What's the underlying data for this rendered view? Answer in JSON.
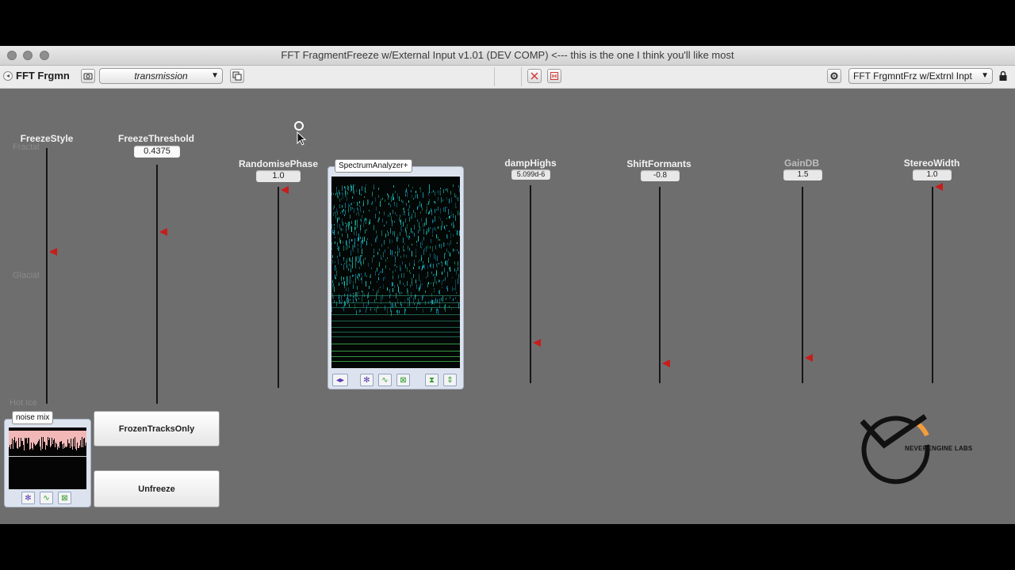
{
  "window": {
    "title": "FFT FragmentFreeze w/External Input v1.01 (DEV COMP)  <--- this is the one I think you'll like most"
  },
  "toolbar": {
    "device_name": "FFT Frgmn",
    "preset": "transmission",
    "device_select": "FFT FrgmntFrz w/Extrnl Inpt"
  },
  "params": {
    "freeze_style": {
      "label": "FreezeStyle",
      "options": [
        "Fractal",
        "Glacial",
        "Hot Ice"
      ]
    },
    "freeze_threshold": {
      "label": "FreezeThreshold",
      "value": "0.4375"
    },
    "randomise_phase": {
      "label": "RandomisePhase",
      "value": "1.0"
    },
    "damp_highs": {
      "label": "dampHighs",
      "value": "5.099d-6"
    },
    "shift_formants": {
      "label": "ShiftFormants",
      "value": "-0.8"
    },
    "gain_db": {
      "label": "GainDB",
      "value": "1.5"
    },
    "stereo_width": {
      "label": "StereoWidth",
      "value": "1.0"
    }
  },
  "spectrum": {
    "label": "SpectrumAnalyzer+"
  },
  "noise_mix": {
    "label": "noise mix"
  },
  "buttons": {
    "frozen_tracks_only": "FrozenTracksOnly",
    "unfreeze": "Unfreeze"
  },
  "logo": {
    "text": "NEVERENGINE LABS"
  },
  "colors": {
    "panel_bg": "#6e6e6e",
    "slider_handle": "#c81c1c",
    "logo_accent": "#f39c3c"
  }
}
